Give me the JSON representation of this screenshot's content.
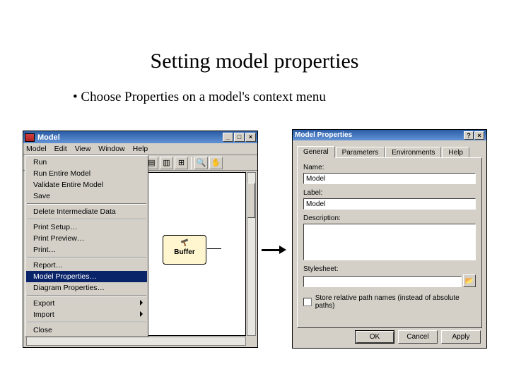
{
  "title": "Setting model properties",
  "bullet": "• Choose Properties on a model's context menu",
  "leftWindow": {
    "title": "Model",
    "winButtons": {
      "min": "_",
      "max": "□",
      "close": "×"
    },
    "menubar": [
      "Model",
      "Edit",
      "View",
      "Window",
      "Help"
    ],
    "toolbarIcons": [
      "□",
      "▦",
      "▤",
      "▥",
      "⊞",
      "🔍",
      "✋"
    ]
  },
  "contextMenu": {
    "items": [
      "Run",
      "Run Entire Model",
      "Validate Entire Model",
      "Save",
      "-",
      "Delete Intermediate Data",
      "-",
      "Print Setup…",
      "Print Preview…",
      "Print…",
      "-",
      "Report…",
      "Model Properties…",
      "Diagram Properties…",
      "-",
      "Export",
      "Import",
      "-",
      "Close"
    ],
    "selectedIndex": 12,
    "submenuIndices": [
      15,
      16
    ]
  },
  "node": {
    "label": "Buffer"
  },
  "rightDialog": {
    "title": "Model Properties",
    "winButtons": {
      "help": "?",
      "close": "×"
    },
    "tabs": [
      "General",
      "Parameters",
      "Environments",
      "Help"
    ],
    "activeTab": 0,
    "fields": {
      "nameLabel": "Name:",
      "nameValue": "Model",
      "labelLabel": "Label:",
      "labelValue": "Model",
      "descLabel": "Description:",
      "styleLabel": "Stylesheet:",
      "checkboxLabel": "Store relative path names (instead of absolute paths)"
    },
    "buttons": {
      "ok": "OK",
      "cancel": "Cancel",
      "apply": "Apply"
    }
  }
}
